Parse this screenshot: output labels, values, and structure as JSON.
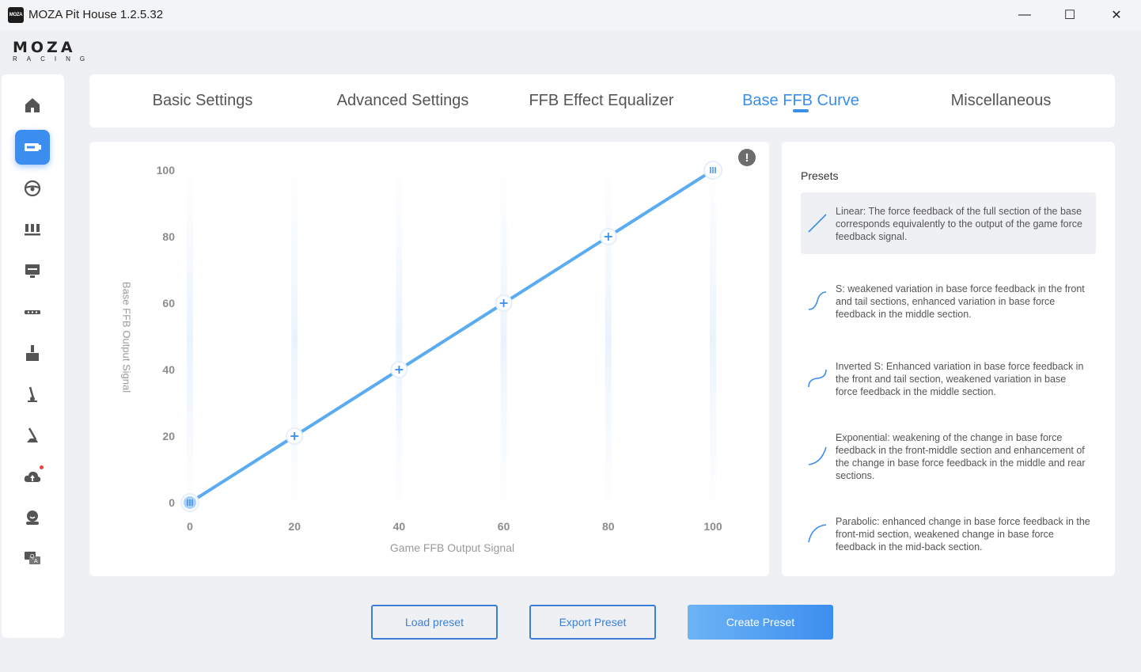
{
  "window": {
    "title": "MOZA Pit House 1.2.5.32",
    "app_icon_text": "MOZA",
    "minimize": "—",
    "maximize": "☐",
    "close": "✕"
  },
  "logo": {
    "top": "MOZA",
    "bottom": "RACING"
  },
  "sidebar": {
    "items": [
      {
        "icon": "home-icon"
      },
      {
        "icon": "wheelbase-icon",
        "active": true
      },
      {
        "icon": "steering-wheel-icon"
      },
      {
        "icon": "pedals-icon"
      },
      {
        "icon": "dashboard-display-icon"
      },
      {
        "icon": "wheel-rim-icon"
      },
      {
        "icon": "shifter-icon"
      },
      {
        "icon": "handbrake-icon"
      },
      {
        "icon": "sequential-shifter-icon"
      },
      {
        "icon": "cloud-upload-icon",
        "notification": true
      },
      {
        "icon": "user-profile-icon"
      },
      {
        "icon": "help-chat-icon"
      }
    ]
  },
  "tabs": [
    {
      "label": "Basic Settings"
    },
    {
      "label": "Advanced Settings"
    },
    {
      "label": "FFB Effect Equalizer"
    },
    {
      "label": "Base FFB Curve",
      "active": true
    },
    {
      "label": "Miscellaneous"
    }
  ],
  "chart": {
    "info": "!",
    "xlabel": "Game FFB Output Signal",
    "ylabel": "Base FFB Output Signal"
  },
  "chart_data": {
    "type": "line",
    "x": [
      0,
      20,
      40,
      60,
      80,
      100
    ],
    "series": [
      {
        "values": [
          0,
          20,
          40,
          60,
          80,
          100
        ]
      }
    ],
    "xticks": [
      "0",
      "20",
      "40",
      "60",
      "80",
      "100"
    ],
    "yticks": [
      "0",
      "20",
      "40",
      "60",
      "80",
      "100"
    ],
    "xlim": [
      0,
      100
    ],
    "ylim": [
      0,
      100
    ],
    "xlabel": "Game FFB Output Signal",
    "ylabel": "Base FFB Output Signal",
    "grid": "vertical",
    "line_color": "#5aabf2"
  },
  "presets": {
    "title": "Presets",
    "items": [
      {
        "name": "linear",
        "text": "Linear: The force feedback of the full section of the base corresponds equivalently to the output of the game force feedback signal.",
        "selected": true
      },
      {
        "name": "s-curve",
        "text": "S: weakened variation in base force feedback in the front and tail sections, enhanced variation in base force feedback in the middle section."
      },
      {
        "name": "inverted-s",
        "text": "Inverted S: Enhanced variation in base force feedback in the front and tail section, weakened variation in base force feedback in the middle section."
      },
      {
        "name": "exponential",
        "text": "Exponential: weakening of the change in base force feedback in the front-middle section and enhancement of the change in base force feedback in the middle and rear sections."
      },
      {
        "name": "parabolic",
        "text": "Parabolic: enhanced change in base force feedback in the front-mid section, weakened change in base force feedback in the mid-back section."
      }
    ]
  },
  "buttons": {
    "load": "Load preset",
    "export": "Export Preset",
    "create": "Create Preset"
  },
  "colors": {
    "accent": "#3a8eea",
    "active_nav": "#3b8df0",
    "curve": "#5aabf2"
  }
}
